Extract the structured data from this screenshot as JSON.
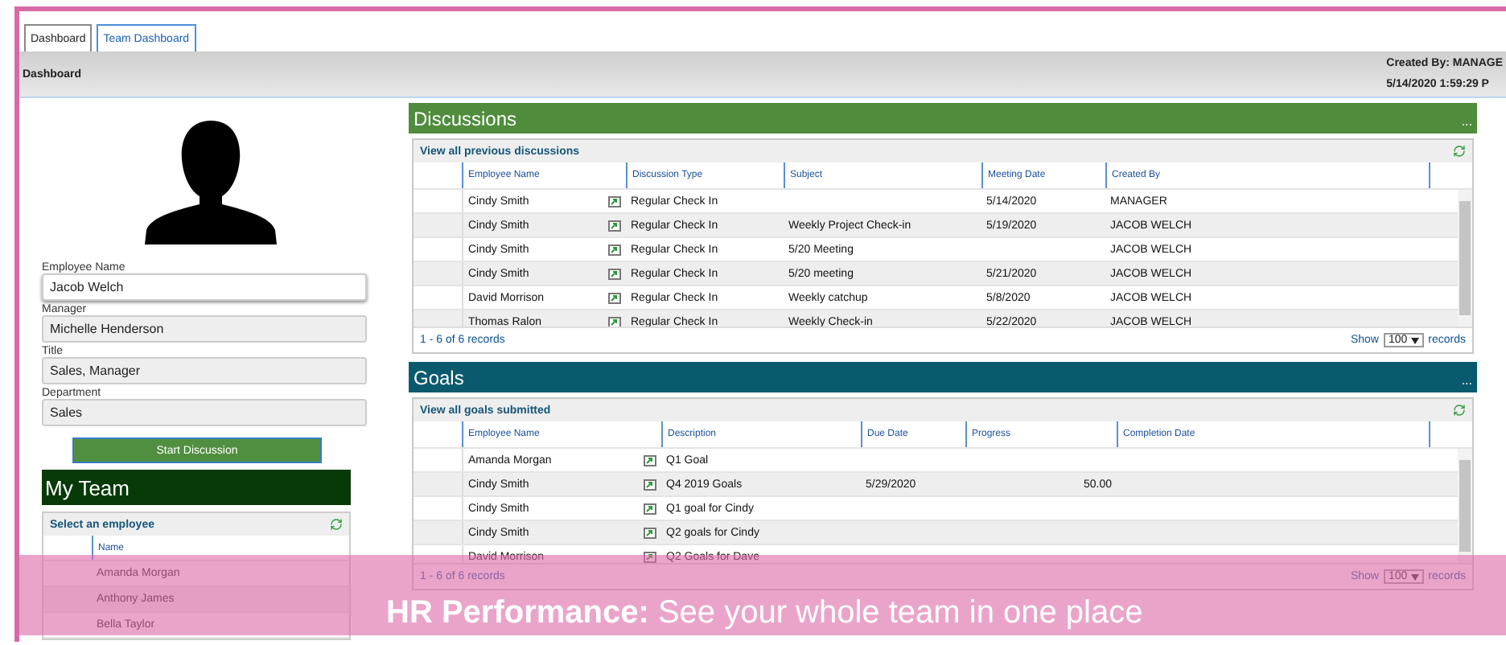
{
  "tabs": [
    {
      "label": "Dashboard",
      "selected": true
    },
    {
      "label": "Team Dashboard",
      "selected": false
    }
  ],
  "header": {
    "title": "Dashboard",
    "created_by": "Created By: MANAGE",
    "timestamp": "5/14/2020 1:59:29 P"
  },
  "profile": {
    "fields": [
      {
        "label": "Employee Name",
        "value": "Jacob Welch",
        "editable": true
      },
      {
        "label": "Manager",
        "value": "Michelle Henderson",
        "editable": false
      },
      {
        "label": "Title",
        "value": "Sales, Manager",
        "editable": false
      },
      {
        "label": "Department",
        "value": "Sales",
        "editable": false
      }
    ],
    "action": "Start Discussion"
  },
  "my_team": {
    "title": "My Team",
    "link": "Select an employee",
    "column": "Name",
    "rows": [
      "Amanda Morgan",
      "Anthony James",
      "Bella Taylor"
    ]
  },
  "discussions": {
    "title": "Discussions",
    "more": "...",
    "link": "View all previous discussions",
    "columns": [
      "Employee Name",
      "Discussion Type",
      "Subject",
      "Meeting Date",
      "Created By"
    ],
    "rows": [
      [
        "Cindy Smith",
        "Regular Check In",
        "",
        "5/14/2020",
        "MANAGER"
      ],
      [
        "Cindy Smith",
        "Regular Check In",
        "Weekly Project Check-in",
        "5/19/2020",
        "JACOB WELCH"
      ],
      [
        "Cindy Smith",
        "Regular Check In",
        "5/20 Meeting",
        "",
        "JACOB WELCH"
      ],
      [
        "Cindy Smith",
        "Regular Check In",
        "5/20 meeting",
        "5/21/2020",
        "JACOB WELCH"
      ],
      [
        "David Morrison",
        "Regular Check In",
        "Weekly catchup",
        "5/8/2020",
        "JACOB WELCH"
      ],
      [
        "Thomas Ralon",
        "Regular Check In",
        "Weekly Check-in",
        "5/22/2020",
        "JACOB WELCH"
      ]
    ],
    "footer": "1 - 6 of 6 records",
    "show": "Show",
    "page_size": "100",
    "records": "records"
  },
  "goals": {
    "title": "Goals",
    "more": "...",
    "link": "View all goals submitted",
    "columns": [
      "Employee Name",
      "Description",
      "Due Date",
      "Progress",
      "Completion Date"
    ],
    "rows": [
      [
        "Amanda Morgan",
        "Q1 Goal",
        "",
        "",
        ""
      ],
      [
        "Cindy Smith",
        "Q4 2019 Goals",
        "5/29/2020",
        "50.00",
        ""
      ],
      [
        "Cindy Smith",
        "Q1 goal for Cindy",
        "",
        "",
        ""
      ],
      [
        "Cindy Smith",
        "Q2 goals for Cindy",
        "",
        "",
        ""
      ],
      [
        "David Morrison",
        "Q2 Goals for Dave",
        "",
        "",
        ""
      ]
    ],
    "footer": "1 - 6 of 6 records",
    "show": "Show",
    "page_size": "100",
    "records": "records"
  },
  "banner": "**HR Performance:** See your whole team in one place"
}
